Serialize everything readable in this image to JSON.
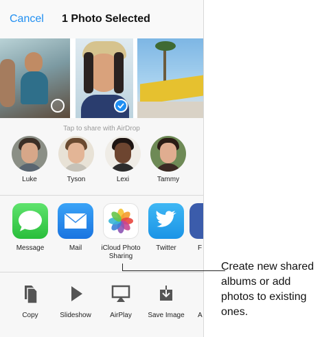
{
  "navbar": {
    "cancel_label": "Cancel",
    "title": "1 Photo Selected"
  },
  "photos": [
    {
      "name": "photo-beach-friends",
      "selected": false
    },
    {
      "name": "photo-woman-hat",
      "selected": true
    },
    {
      "name": "photo-palm-sign",
      "selected": false
    }
  ],
  "airdrop": {
    "hint": "Tap to share with AirDrop",
    "people": [
      "Luke",
      "Tyson",
      "Lexi",
      "Tammy"
    ]
  },
  "share_apps": [
    {
      "label": "Message",
      "icon": "message-icon"
    },
    {
      "label": "Mail",
      "icon": "mail-icon"
    },
    {
      "label": "iCloud Photo Sharing",
      "icon": "photos-icon"
    },
    {
      "label": "Twitter",
      "icon": "twitter-icon"
    },
    {
      "label": "F",
      "icon": "facebook-icon"
    }
  ],
  "actions": [
    {
      "label": "Copy",
      "icon": "copy-icon"
    },
    {
      "label": "Slideshow",
      "icon": "slideshow-icon"
    },
    {
      "label": "AirPlay",
      "icon": "airplay-icon"
    },
    {
      "label": "Save Image",
      "icon": "save-image-icon"
    },
    {
      "label": "A",
      "icon": "assign-icon"
    }
  ],
  "callout": {
    "text": "Create new shared albums or add photos to existing ones."
  },
  "colors": {
    "accent": "#1f8ef1",
    "message": "#3ec94a",
    "mail": "#1f8ef1",
    "twitter": "#2aa8f2",
    "facebook": "#3b5cab"
  }
}
